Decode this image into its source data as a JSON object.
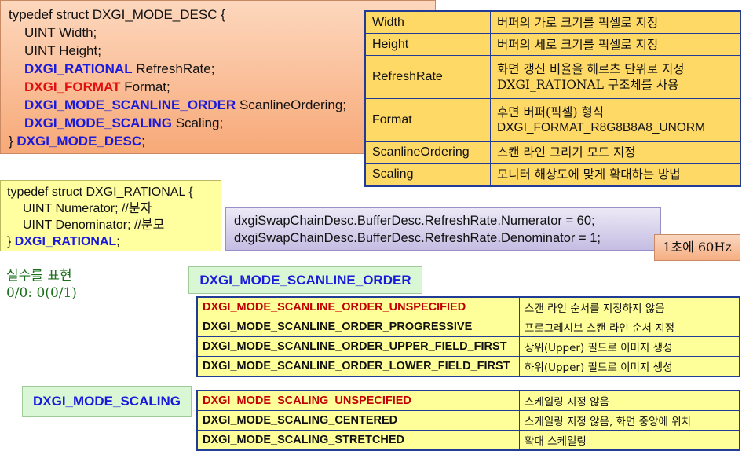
{
  "struct_mode_desc": {
    "lines": [
      {
        "prefix": "typedef struct DXGI_MODE_DESC {",
        "type": "",
        "name": ""
      },
      {
        "prefix": "",
        "type": "",
        "name": "UINT Width;"
      },
      {
        "prefix": "",
        "type": "",
        "name": "UINT Height;"
      },
      {
        "prefix": "",
        "type": "DXGI_RATIONAL",
        "name": " RefreshRate;"
      },
      {
        "prefix": "",
        "type": "DXGI_FORMAT",
        "name": " Format;"
      },
      {
        "prefix": "",
        "type": "DXGI_MODE_SCANLINE_ORDER",
        "name": " ScanlineOrdering;"
      },
      {
        "prefix": "",
        "type": "DXGI_MODE_SCALING",
        "name": " Scaling;"
      },
      {
        "prefix": "} ",
        "type": "DXGI_MODE_DESC",
        "name": ";"
      }
    ]
  },
  "member_table": {
    "rows": [
      {
        "name": "Width",
        "desc": "버퍼의 가로 크기를 픽셀로 지정",
        "desc2": ""
      },
      {
        "name": "Height",
        "desc": "버퍼의 세로 크기를 픽셀로 지정",
        "desc2": ""
      },
      {
        "name": "RefreshRate",
        "desc": "화면 갱신 비율을 헤르츠 단위로 지정",
        "desc2": "DXGI_RATIONAL 구조체를 사용"
      },
      {
        "name": "Format",
        "desc": "후면 버퍼(픽셀) 형식",
        "desc2": "DXGI_FORMAT_R8G8B8A8_UNORM"
      },
      {
        "name": "ScanlineOrdering",
        "desc": "스캔 라인 그리기 모드 지정",
        "desc2": ""
      },
      {
        "name": "Scaling",
        "desc": "모니터 해상도에 맞게 확대하는 방법",
        "desc2": ""
      }
    ]
  },
  "struct_rational": {
    "l1": "typedef struct DXGI_RATIONAL {",
    "l2": "UINT Numerator; //분자",
    "l3": "UINT Denominator; //분모",
    "l4_prefix": "} ",
    "l4_type": "DXGI_RATIONAL",
    "l4_suffix": ";"
  },
  "refresh_code": {
    "l1": "dxgiSwapChainDesc.BufferDesc.RefreshRate.Numerator = 60;",
    "l2": "dxgiSwapChainDesc.BufferDesc.RefreshRate.Denominator = 1;"
  },
  "hz_label": "1초에 60Hz",
  "real_note": {
    "l1": "실수를 표현",
    "l2": "0/0: 0(0/1)"
  },
  "scanline_header": "DXGI_MODE_SCANLINE_ORDER",
  "scanline_table": [
    {
      "name": "DXGI_MODE_SCANLINE_ORDER_UNSPECIFIED",
      "desc": "스캔 라인 순서를 지정하지 않음",
      "red": true
    },
    {
      "name": "DXGI_MODE_SCANLINE_ORDER_PROGRESSIVE",
      "desc": "프로그레시브 스캔 라인 순서 지정",
      "red": false
    },
    {
      "name": "DXGI_MODE_SCANLINE_ORDER_UPPER_FIELD_FIRST",
      "desc": "상위(Upper) 필드로 이미지 생성",
      "red": false
    },
    {
      "name": "DXGI_MODE_SCANLINE_ORDER_LOWER_FIELD_FIRST",
      "desc": "하위(Upper) 필드로 이미지 생성",
      "red": false
    }
  ],
  "scaling_header": "DXGI_MODE_SCALING",
  "scaling_table": [
    {
      "name": "DXGI_MODE_SCALING_UNSPECIFIED",
      "desc": "스케일링 지정 않음",
      "red": true
    },
    {
      "name": "DXGI_MODE_SCALING_CENTERED",
      "desc": "스케일링 지정 않음, 화면 중앙에 위치",
      "red": false
    },
    {
      "name": "DXGI_MODE_SCALING_STRETCHED",
      "desc": "확대 스케일링",
      "red": false
    }
  ],
  "colors": {
    "keyword_blue": "#1a1adb",
    "keyword_red": "#e01010",
    "table_border": "#203c96"
  }
}
